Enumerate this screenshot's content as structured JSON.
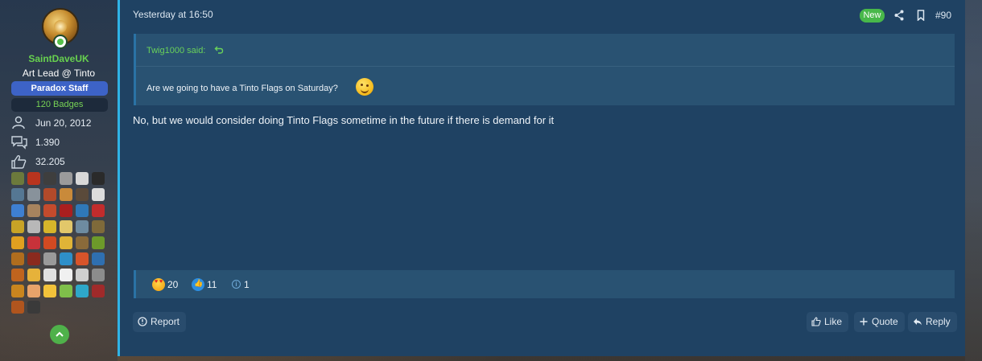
{
  "user": {
    "username": "SaintDaveUK",
    "title": "Art Lead @ Tinto",
    "staff_badge": "Paradox Staff",
    "badges_count": "120 Badges",
    "join_date": "Jun 20, 2012",
    "messages": "1.390",
    "reaction_score": "32.205",
    "stat_icons": [
      "person-icon",
      "chat-bubbles-icon",
      "thumbs-up-icon"
    ]
  },
  "post": {
    "date": "Yesterday at 16:50",
    "new_label": "New",
    "number": "#90",
    "quote": {
      "author": "Twig1000 said:",
      "text": "Are we going to have a Tinto Flags on Saturday?",
      "emoji": "wink-emoji"
    },
    "body": "No, but we would consider doing Tinto Flags sometime in the future if there is demand for it",
    "reactions": [
      {
        "type": "love-eyes-emoji",
        "count": "20"
      },
      {
        "type": "like-emoji",
        "count": "11"
      },
      {
        "type": "info-emoji",
        "count": "1"
      }
    ],
    "actions": {
      "report": "Report",
      "like": "Like",
      "quote": "Quote",
      "reply": "Reply"
    }
  },
  "colors": {
    "accent_green": "#67d14f",
    "staff_blue": "#3d63c7",
    "post_bg": "#1f4263",
    "quote_bg": "#295272",
    "accent_bar": "#2fb3e6"
  }
}
